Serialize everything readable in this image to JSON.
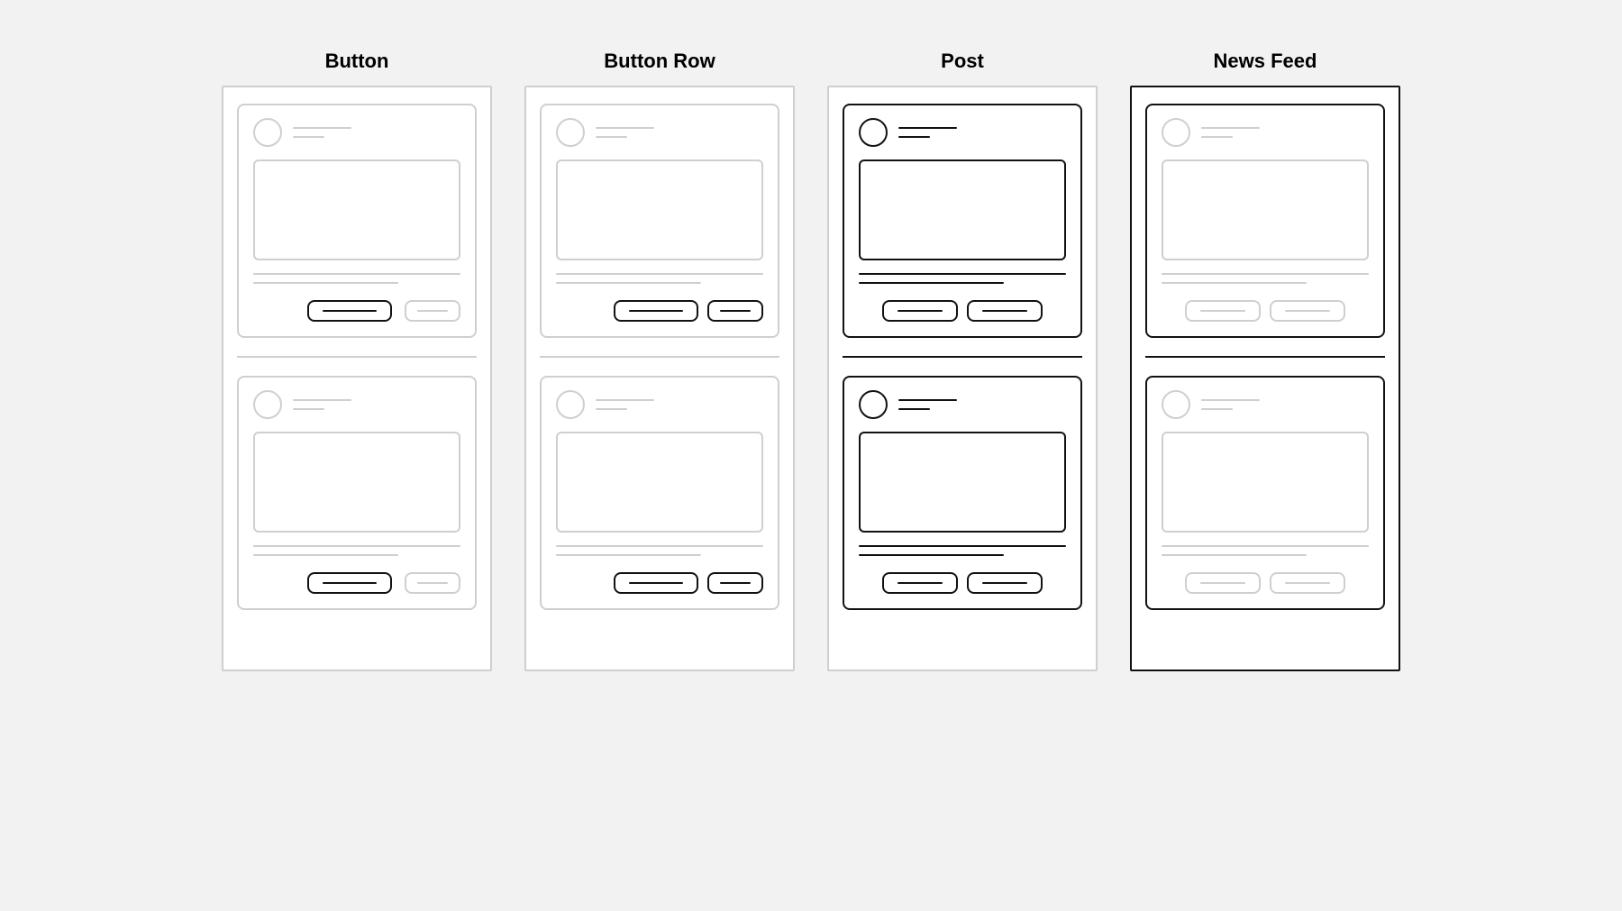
{
  "columns": [
    {
      "id": "button",
      "title": "Button"
    },
    {
      "id": "button-row",
      "title": "Button Row"
    },
    {
      "id": "post",
      "title": "Post"
    },
    {
      "id": "news-feed",
      "title": "News Feed"
    }
  ]
}
